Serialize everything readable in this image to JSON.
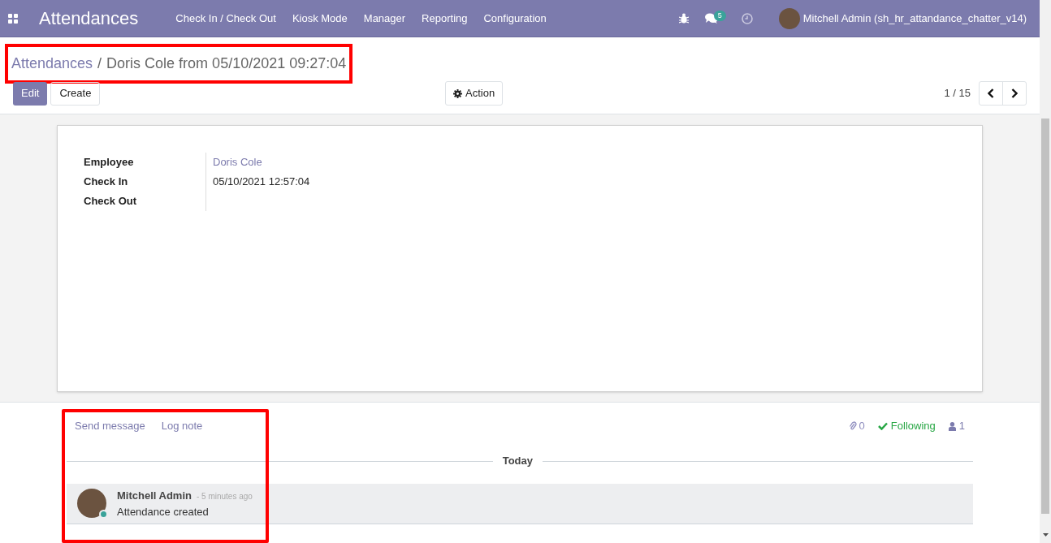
{
  "navbar": {
    "app_title": "Attendances",
    "menu": [
      "Check In / Check Out",
      "Kiosk Mode",
      "Manager",
      "Reporting",
      "Configuration"
    ],
    "messages_count": "5",
    "user": "Mitchell Admin (sh_hr_attandance_chatter_v14)"
  },
  "breadcrumb": {
    "highlighted": true,
    "parent": "Attendances",
    "separator": "/",
    "current": "Doris Cole from 05/10/2021 09:27:04"
  },
  "buttons": {
    "edit": "Edit",
    "create": "Create",
    "action": "Action"
  },
  "pager": {
    "value": "1 / 15"
  },
  "form": {
    "fields": [
      {
        "label": "Employee",
        "value": "Doris Cole",
        "kind": "link"
      },
      {
        "label": "Check In",
        "value": "05/10/2021 12:57:04",
        "kind": "text"
      },
      {
        "label": "Check Out"
      }
    ]
  },
  "chatter": {
    "highlighted": true,
    "actions": [
      "Send message",
      "Log note"
    ],
    "attachments": "0",
    "following": "Following",
    "followers": "1",
    "date_separator": "Today",
    "messages": [
      {
        "author": "Mitchell Admin",
        "time": "- 5 minutes ago",
        "body": "Attendance created"
      }
    ]
  }
}
